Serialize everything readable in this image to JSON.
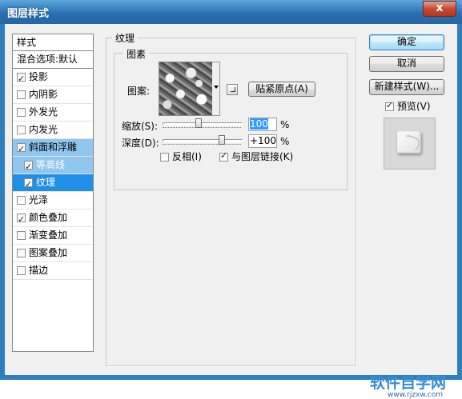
{
  "window": {
    "title": "图层样式",
    "close_glyph": "x"
  },
  "style_list": {
    "header": "样式",
    "blend": "混合选项:默认",
    "items": [
      {
        "label": "投影",
        "checked": true
      },
      {
        "label": "内阴影",
        "checked": false
      },
      {
        "label": "外发光",
        "checked": false
      },
      {
        "label": "内发光",
        "checked": false
      },
      {
        "label": "斜面和浮雕",
        "checked": true
      },
      {
        "label": "等高线",
        "checked": true
      },
      {
        "label": "纹理",
        "checked": true
      },
      {
        "label": "光泽",
        "checked": false
      },
      {
        "label": "颜色叠加",
        "checked": true
      },
      {
        "label": "渐变叠加",
        "checked": false
      },
      {
        "label": "图案叠加",
        "checked": false
      },
      {
        "label": "描边",
        "checked": false
      }
    ]
  },
  "texture": {
    "group_title": "纹理",
    "sub_group_title": "图素",
    "pattern_label": "图案:",
    "snap_origin_button": "贴紧原点(A)",
    "scale_label": "缩放(S):",
    "scale_value": "100",
    "scale_unit": "%",
    "scale_level": 100,
    "depth_label": "深度(D):",
    "depth_value": "+100",
    "depth_unit": "%",
    "depth_level": 100,
    "invert_label": "反相(I)",
    "invert_checked": false,
    "link_label": "与图层链接(K)",
    "link_checked": true
  },
  "buttons": {
    "ok": "确定",
    "cancel": "取消",
    "new_style": "新建样式(W)...",
    "preview_label": "预览(V)",
    "preview_checked": true
  },
  "watermark": {
    "text": "软件自学网",
    "url": "www.rjzxw.com"
  }
}
